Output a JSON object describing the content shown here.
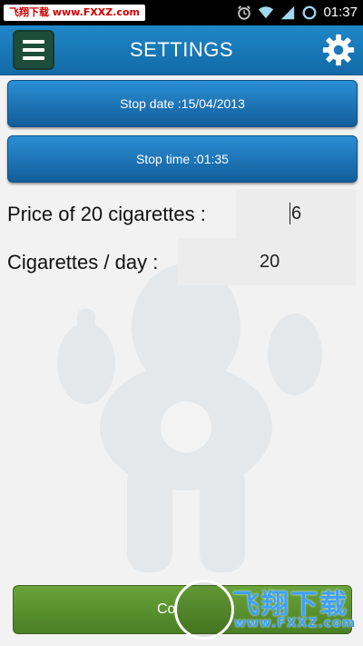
{
  "status_bar": {
    "watermark": "飞翔下载 www.FXXZ.com",
    "time": "01:37",
    "icons": [
      "alarm-icon",
      "wifi-icon",
      "signal-icon",
      "sync-icon"
    ]
  },
  "toolbar": {
    "title": "SETTINGS",
    "menu_icon": "menu-icon",
    "settings_icon": "gear-icon"
  },
  "stop_date_button": {
    "label": "Stop date :15/04/2013"
  },
  "stop_time_button": {
    "label": "Stop time :01:35"
  },
  "price_row": {
    "label": "Price of 20 cigarettes :",
    "value": "6"
  },
  "cigarettes_row": {
    "label": "Cigarettes / day :",
    "value": "20"
  },
  "bottom_button": {
    "label": "Co"
  },
  "watermark": {
    "text": "飞翔下载",
    "url": "www.FXXZ.com"
  },
  "colors": {
    "toolbar": "#1f87c8",
    "button_blue": "#2b8fd4",
    "button_green": "#6aa43a"
  }
}
